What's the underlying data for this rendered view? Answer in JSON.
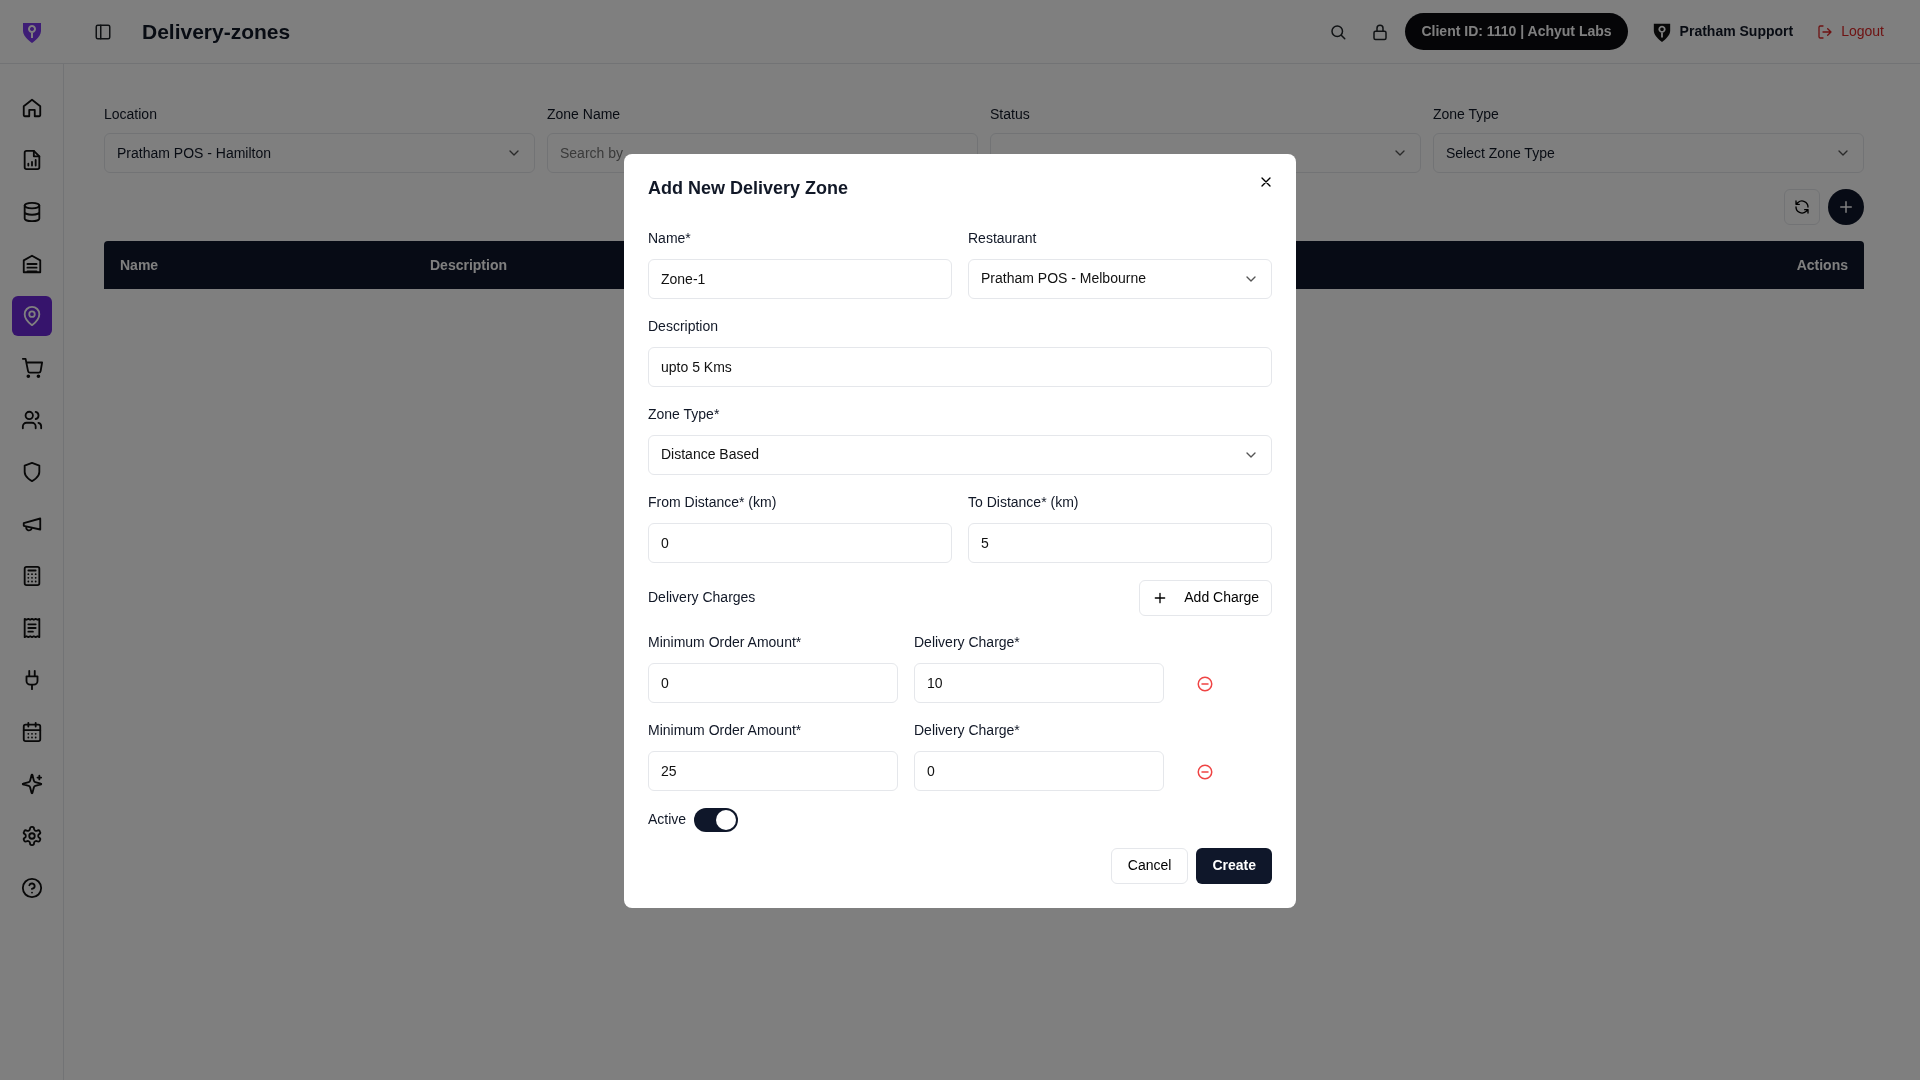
{
  "header": {
    "page_title": "Delivery-zones",
    "client_badge": "Client ID: 1110 | Achyut Labs",
    "user": "Pratham Support",
    "logout": "Logout"
  },
  "sidebar": {
    "items": [
      {
        "selected": false
      },
      {
        "selected": false
      },
      {
        "selected": false
      },
      {
        "selected": false
      },
      {
        "selected": true
      },
      {
        "selected": false
      },
      {
        "selected": false
      },
      {
        "selected": false
      },
      {
        "selected": false
      },
      {
        "selected": false
      },
      {
        "selected": false
      },
      {
        "selected": false
      },
      {
        "selected": false
      },
      {
        "selected": false
      },
      {
        "selected": false
      },
      {
        "selected": false
      }
    ]
  },
  "filters": [
    {
      "label": "Location",
      "kind": "select",
      "value": "Pratham POS - Hamilton"
    },
    {
      "label": "Zone Name",
      "kind": "input",
      "placeholder": "Search by"
    },
    {
      "label": "Status",
      "kind": "select"
    },
    {
      "label": "Zone Type",
      "kind": "select",
      "value": "Select Zone Type"
    }
  ],
  "table": {
    "columns": [
      "Name",
      "Description",
      "Actions"
    ]
  },
  "modal": {
    "title": "Add New Delivery Zone",
    "rows": [
      [
        {
          "label": "Name*",
          "kind": "input",
          "value": "Zone-1"
        },
        {
          "label": "Restaurant",
          "kind": "select",
          "value": "Pratham POS - Melbourne"
        }
      ],
      [
        {
          "label": "Description",
          "kind": "input",
          "value": "upto 5 Kms"
        }
      ],
      [
        {
          "label": "Zone Type*",
          "kind": "select",
          "value": "Distance Based"
        }
      ],
      [
        {
          "label": "From Distance* (km)",
          "kind": "input",
          "value": "0"
        },
        {
          "label": "To Distance* (km)",
          "kind": "input",
          "value": "5"
        }
      ]
    ],
    "charges_title": "Delivery Charges",
    "add_charge": "Add Charge",
    "charges": [
      {
        "min_label": "Minimum Order Amount*",
        "min_value": "0",
        "charge_label": "Delivery Charge*",
        "charge_value": "10"
      },
      {
        "min_label": "Minimum Order Amount*",
        "min_value": "25",
        "charge_label": "Delivery Charge*",
        "charge_value": "0"
      }
    ],
    "active": {
      "label": "Active",
      "on": true
    },
    "cancel": "Cancel",
    "create": "Create"
  }
}
